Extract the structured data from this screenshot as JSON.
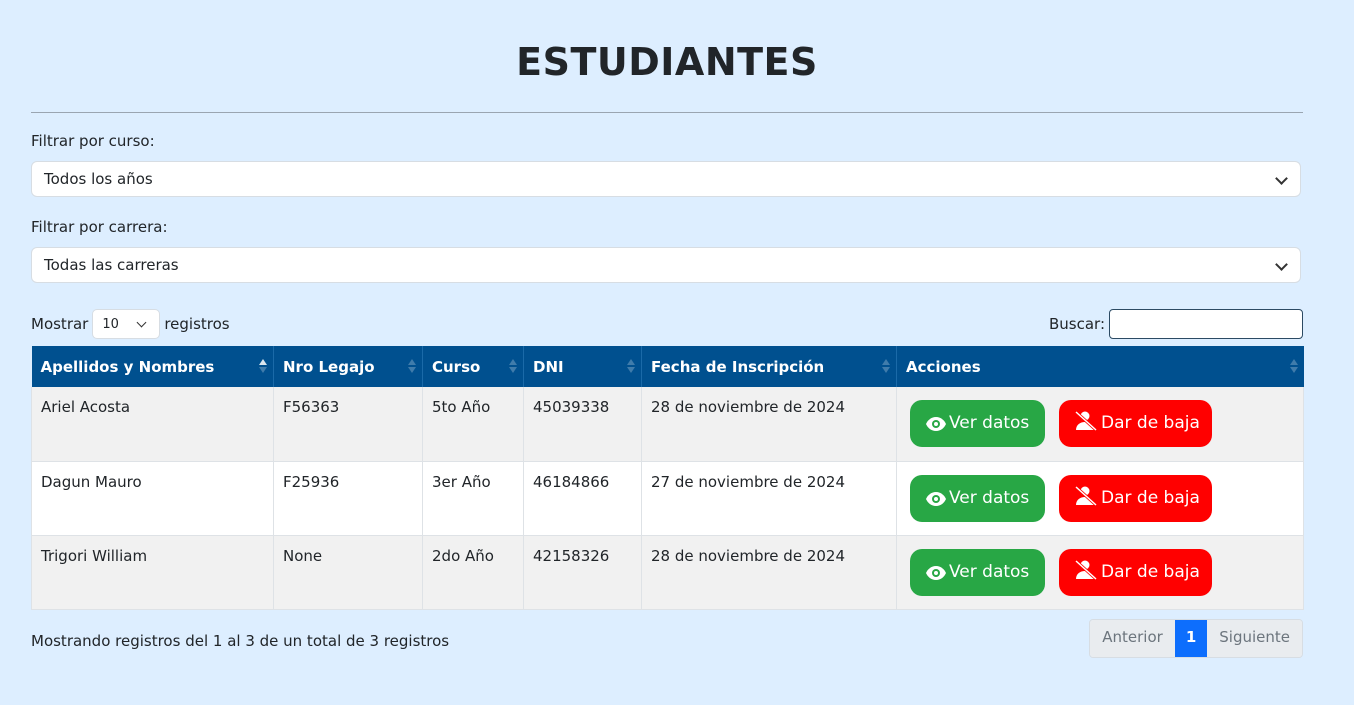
{
  "title": "ESTUDIANTES",
  "filters": {
    "course_label": "Filtrar por curso:",
    "course_value": "Todos los años",
    "career_label": "Filtrar por carrera:",
    "career_value": "Todas las carreras"
  },
  "length": {
    "prefix": "Mostrar",
    "value": "10",
    "suffix": "registros"
  },
  "search": {
    "label": "Buscar:",
    "value": ""
  },
  "table": {
    "headers": [
      "Apellidos y Nombres",
      "Nro Legajo",
      "Curso",
      "DNI",
      "Fecha de Inscripción",
      "Acciones"
    ],
    "rows": [
      {
        "nombre": "Ariel Acosta",
        "legajo": "F56363",
        "curso": "5to Año",
        "dni": "45039338",
        "fecha": "28 de noviembre de 2024"
      },
      {
        "nombre": "Dagun Mauro",
        "legajo": "F25936",
        "curso": "3er Año",
        "dni": "46184866",
        "fecha": "27 de noviembre de 2024"
      },
      {
        "nombre": "Trigori William",
        "legajo": "None",
        "curso": "2do Año",
        "dni": "42158326",
        "fecha": "28 de noviembre de 2024"
      }
    ],
    "view_label": "Ver datos",
    "remove_label": "Dar de baja"
  },
  "info": "Mostrando registros del 1 al 3 de un total de 3 registros",
  "pagination": {
    "prev": "Anterior",
    "current": "1",
    "next": "Siguiente"
  },
  "colors": {
    "header_bg": "#00508f",
    "view_btn": "#28a745",
    "remove_btn": "#ff0000",
    "page_bg": "#ddeeff"
  },
  "icons": {
    "view": "eye-icon",
    "remove": "user-slash-icon"
  }
}
